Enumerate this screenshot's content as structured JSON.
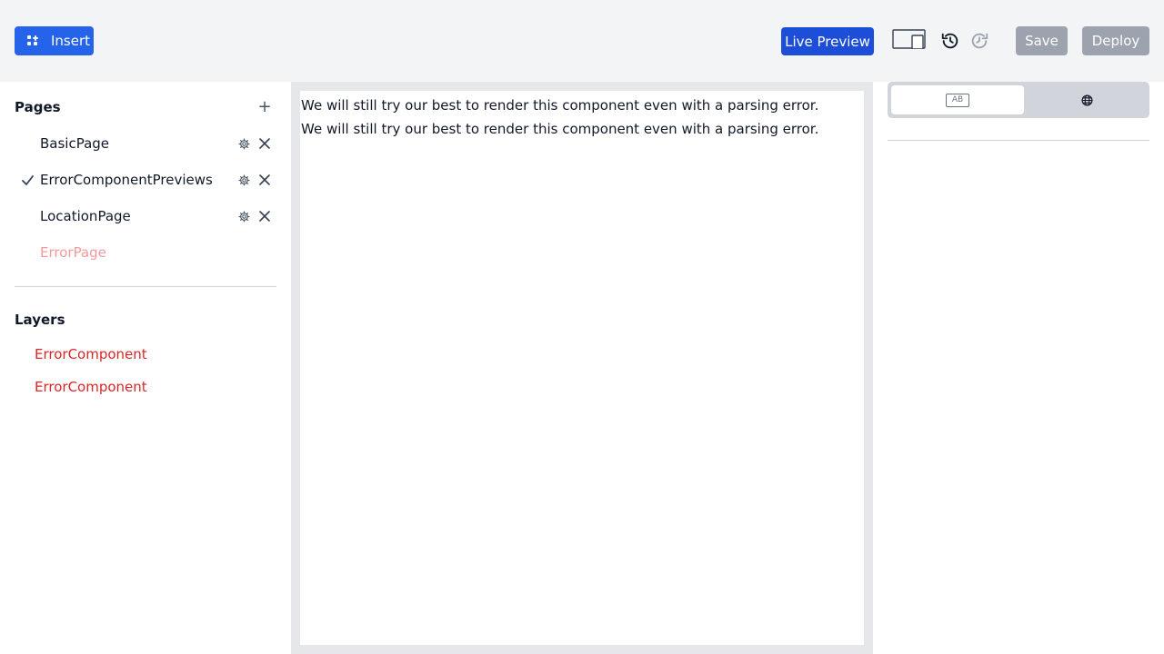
{
  "toolbar": {
    "insert_label": "Insert",
    "live_preview_label": "Live Preview",
    "save_label": "Save",
    "deploy_label": "Deploy"
  },
  "pages": {
    "title": "Pages",
    "items": [
      {
        "label": "BasicPage",
        "selected": false,
        "error": false
      },
      {
        "label": "ErrorComponentPreviews",
        "selected": true,
        "error": false
      },
      {
        "label": "LocationPage",
        "selected": false,
        "error": false
      },
      {
        "label": "ErrorPage",
        "selected": false,
        "error": true
      }
    ]
  },
  "layers": {
    "title": "Layers",
    "items": [
      {
        "label": "ErrorComponent"
      },
      {
        "label": "ErrorComponent"
      }
    ]
  },
  "canvas": {
    "messages": [
      "We will still try our best to render this component even with a parsing error.",
      "We will still try our best to render this component even with a parsing error."
    ]
  },
  "right_panel": {
    "toggle_options": [
      {
        "icon": "text-ab-icon",
        "label": "AB",
        "active": true
      },
      {
        "icon": "globe-icon",
        "active": false
      }
    ]
  },
  "colors": {
    "primary": "#2563eb",
    "live_preview": "#1d4ed8",
    "disabled": "#9ca3af",
    "error_text": "#dc2626",
    "error_page_text": "#f49a9a",
    "topbar_bg": "#f3f4f6"
  }
}
